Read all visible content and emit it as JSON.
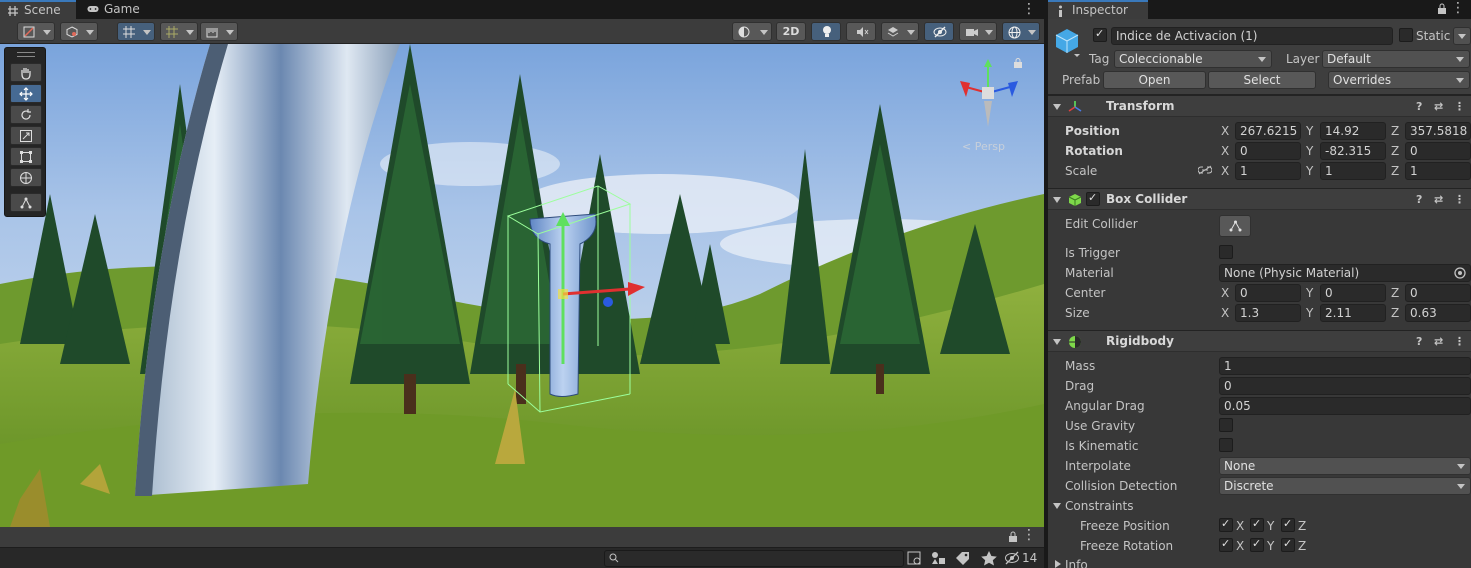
{
  "scene_window": {
    "tabs": [
      {
        "label": "Scene",
        "active": true
      },
      {
        "label": "Game",
        "active": false
      }
    ],
    "toolbar": {
      "mode_2d": "2D"
    },
    "view": {
      "projection_label": "< Persp"
    },
    "status": {
      "search_placeholder": "",
      "hidden_count": "14"
    }
  },
  "inspector": {
    "tab_label": "Inspector",
    "object": {
      "active": true,
      "name": "Indice de Activacion (1)",
      "static_label": "Static",
      "tag_label": "Tag",
      "tag_value": "Coleccionable",
      "layer_label": "Layer",
      "layer_value": "Default",
      "prefab_label": "Prefab",
      "prefab_open": "Open",
      "prefab_select": "Select",
      "prefab_overrides": "Overrides"
    },
    "transform": {
      "title": "Transform",
      "position": {
        "label": "Position",
        "x": "267.6215",
        "y": "14.92",
        "z": "357.5818"
      },
      "rotation": {
        "label": "Rotation",
        "x": "0",
        "y": "-82.315",
        "z": "0"
      },
      "scale": {
        "label": "Scale",
        "x": "1",
        "y": "1",
        "z": "1"
      }
    },
    "box_collider": {
      "title": "Box Collider",
      "enabled": true,
      "edit_collider": "Edit Collider",
      "is_trigger": "Is Trigger",
      "material_label": "Material",
      "material_value": "None (Physic Material)",
      "center": {
        "label": "Center",
        "x": "0",
        "y": "0",
        "z": "0"
      },
      "size": {
        "label": "Size",
        "x": "1.3",
        "y": "2.11",
        "z": "0.63"
      }
    },
    "rigidbody": {
      "title": "Rigidbody",
      "mass": {
        "label": "Mass",
        "value": "1"
      },
      "drag": {
        "label": "Drag",
        "value": "0"
      },
      "angular_drag": {
        "label": "Angular Drag",
        "value": "0.05"
      },
      "use_gravity": "Use Gravity",
      "is_kinematic": "Is Kinematic",
      "interpolate": {
        "label": "Interpolate",
        "value": "None"
      },
      "collision": {
        "label": "Collision Detection",
        "value": "Discrete"
      },
      "constraints": "Constraints",
      "freeze_position": "Freeze Position",
      "freeze_rotation": "Freeze Rotation",
      "info": "Info"
    },
    "axis_labels": {
      "x": "X",
      "y": "Y",
      "z": "Z"
    }
  },
  "colors": {
    "accent": "#3a79bb",
    "panel": "#383838",
    "field": "#2a2a2a"
  }
}
